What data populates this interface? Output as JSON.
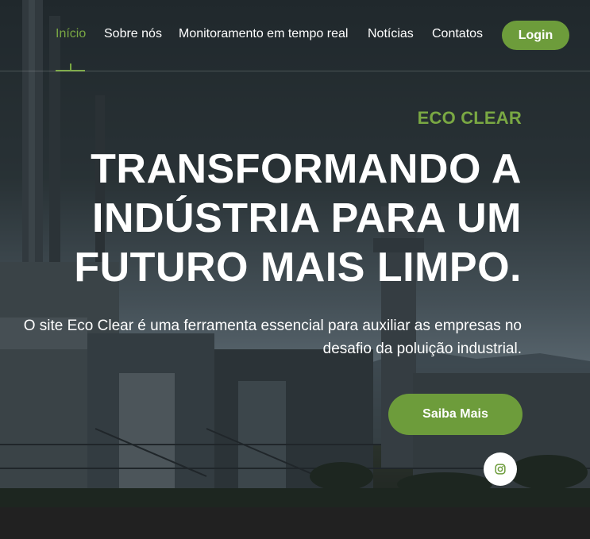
{
  "nav": {
    "items": [
      {
        "label": "Início",
        "active": true
      },
      {
        "label": "Sobre nós",
        "active": false
      },
      {
        "label": "Monitoramento em tempo real",
        "active": false
      },
      {
        "label": "Notícias",
        "active": false
      },
      {
        "label": "Contatos",
        "active": false
      }
    ],
    "login_label": "Login"
  },
  "hero": {
    "brand": "ECO CLEAR",
    "headline_lines": [
      "TRANSFORMANDO A",
      "INDÚSTRIA PARA UM",
      "FUTURO MAIS LIMPO."
    ],
    "subtitle_lines": [
      "O site Eco Clear é uma ferramenta essencial para auxiliar as empresas no",
      "desafio da poluição industrial."
    ],
    "cta_label": "Saiba Mais",
    "social_icon": "instagram-icon"
  },
  "colors": {
    "accent": "#7aa843",
    "button": "#6d9c3b",
    "text": "#ffffff",
    "footer": "#212121"
  }
}
